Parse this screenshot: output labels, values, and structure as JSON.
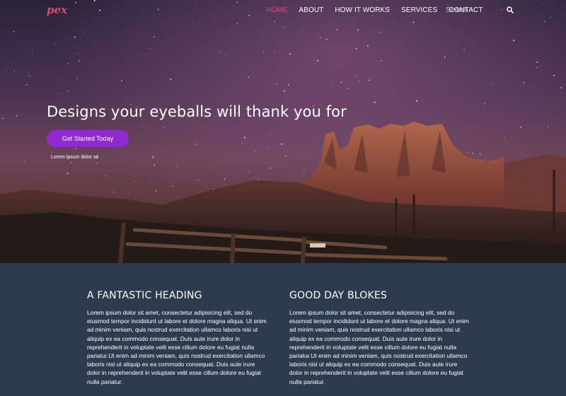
{
  "nav": {
    "logo": "pex",
    "items": [
      {
        "label": "HOME",
        "active": true
      },
      {
        "label": "ABOUT",
        "active": false
      },
      {
        "label": "HOW IT WORKS",
        "active": false
      },
      {
        "label": "SERVICES",
        "active": false
      },
      {
        "label": "CONTACT",
        "active": false
      }
    ],
    "search_placeholder": "Search",
    "accent_color": "#e0457b"
  },
  "hero": {
    "title": "Designs your eyeballs will thank you for",
    "cta_label": "Get Started Today",
    "cta_color": "#8f2ad0",
    "subtext": "Lorem ipsum dolor sit"
  },
  "columns": [
    {
      "heading": "A FANTASTIC HEADING",
      "body": "Lorem ipsum dolor sit amet, consectetur adipisicing elit, sed do eiusmod tempor incididunt ut labore et dolore magna aliqua. Ut enim ad minim veniam, quis nostrud exercitation ullamco laboris nisi ut aliquip ex ea commodo consequat. Duis aute irure dolor in reprehenderit in voluptate velit esse cillum dolore eu fugiat nulla pariatur.Ut enim ad minim veniam, quis nostrud exercitation ullamco laboris nisi ut aliquip ex ea commodo consequat. Duis aute irure dolor in reprehenderit in voluptate velit esse cillum dolore eu fugiat nulla pariatur."
    },
    {
      "heading": "GOOD DAY BLOKES",
      "body": "Lorem ipsum dolor sit amet, consectetur adipisicing elit, sed do eiusmod tempor incididunt ut labore et dolore magna aliqua. Ut enim ad minim veniam, quis nostrud exercitation ullamco laboris nisi ut aliquip ex ea commodo consequat. Duis aute irure dolor in reprehenderit in voluptate velit esse cillum dolore eu fugiat nulla pariatur.Ut enim ad minim veniam, quis nostrud exercitation ullamco laboris nisi ut aliquip ex ea commodo consequat. Duis aute irure dolor in reprehenderit in voluptate velit esse cillum dolore eu fugiat nulla pariatur."
    }
  ],
  "content_bg": "#2e3b4e"
}
